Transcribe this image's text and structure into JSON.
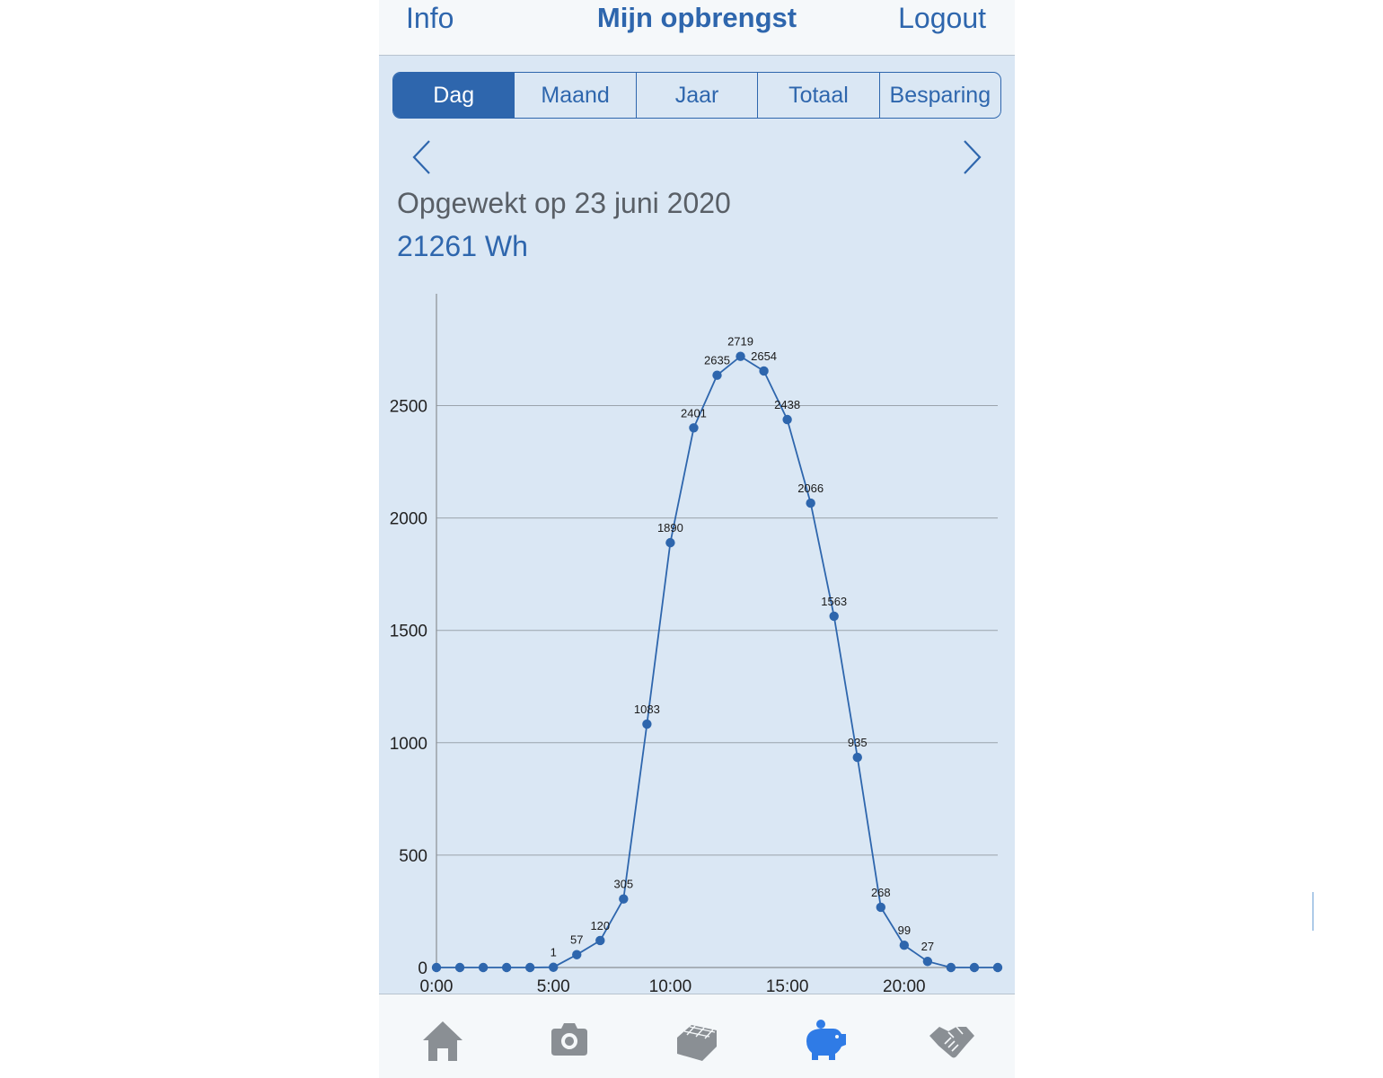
{
  "header": {
    "info_label": "Info",
    "title": "Mijn opbrengst",
    "logout_label": "Logout"
  },
  "tabs": [
    "Dag",
    "Maand",
    "Jaar",
    "Totaal",
    "Besparing"
  ],
  "active_tab": "Dag",
  "summary": {
    "label": "Opgewekt op 23 juni 2020",
    "total": "21261 Wh"
  },
  "chart_data": {
    "type": "line",
    "x": [
      0,
      1,
      2,
      3,
      4,
      5,
      6,
      7,
      8,
      9,
      10,
      11,
      12,
      13,
      14,
      15,
      16,
      17,
      18,
      19,
      20,
      21,
      22,
      23,
      24
    ],
    "values": [
      0,
      0,
      0,
      0,
      0,
      1,
      57,
      120,
      305,
      1083,
      1890,
      2401,
      2635,
      2719,
      2654,
      2438,
      2066,
      1563,
      935,
      268,
      99,
      27,
      0,
      0,
      0
    ],
    "point_labels": [
      "",
      "",
      "",
      "",
      "",
      "1",
      "57",
      "120",
      "305",
      "1083",
      "1890",
      "2401",
      "2635",
      "2719",
      "2654",
      "2438",
      "2066",
      "1563",
      "935",
      "268",
      "99",
      "27",
      "",
      "",
      ""
    ],
    "x_ticks": [
      "0:00",
      "5:00",
      "10:00",
      "15:00",
      "20:00"
    ],
    "y_ticks": [
      "0",
      "500",
      "1000",
      "1500",
      "2000",
      "2500"
    ],
    "ylim": [
      0,
      3000
    ],
    "xlim": [
      0,
      24
    ],
    "grid": true,
    "color": "#2e66ad"
  },
  "tabbar": {
    "items": [
      {
        "icon": "home-icon"
      },
      {
        "icon": "camera-icon"
      },
      {
        "icon": "solar-panel-icon"
      },
      {
        "icon": "piggy-bank-icon"
      },
      {
        "icon": "handshake-icon"
      }
    ],
    "active_index": 3,
    "active_color": "#2f7be6",
    "inactive_color": "#8a8f94"
  }
}
